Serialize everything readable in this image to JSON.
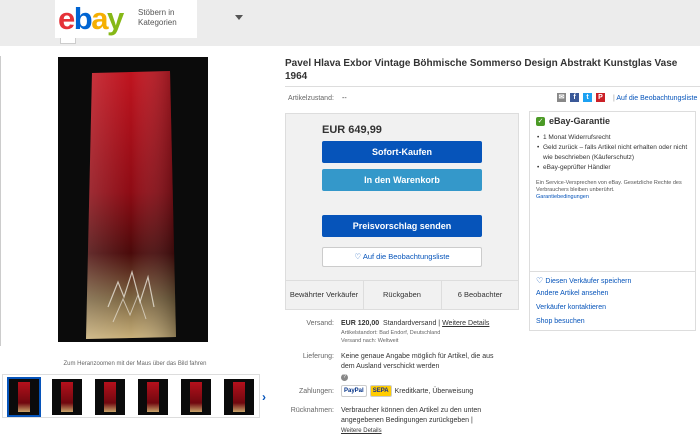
{
  "header": {
    "logo": {
      "e": "e",
      "b": "b",
      "a": "a",
      "y": "y"
    },
    "categories_label": "Stöbern in Kategorien"
  },
  "gallery": {
    "zoom_hint": "Zum Heranzoomen mit der Maus über das Bild fahren",
    "next_icon": "›"
  },
  "item": {
    "title": "Pavel Hlava Exbor Vintage Böhmische Sommerso Design Abstrakt Kunstglas Vase 1964",
    "condition_label": "Artikelzustand:",
    "condition_value": "--",
    "watchlist_link": "Auf die Beobachtungsliste"
  },
  "buybox": {
    "price": "EUR 649,99",
    "buy_now": "Sofort-Kaufen",
    "add_to_cart": "In den Warenkorb",
    "make_offer": "Preisvorschlag senden",
    "watch": "Auf die Beobachtungsliste",
    "stats": [
      "Bewährter Verkäufer",
      "Rückgaben",
      "6 Beobachter"
    ]
  },
  "guarantee": {
    "title": "eBay-Garantie",
    "items": [
      "1 Monat Widerrufsrecht",
      "Geld zurück – falls Artikel nicht erhalten oder nicht wie beschrieben (Käuferschutz)",
      "eBay-geprüfter Händler"
    ],
    "note": "Ein Service-Versprechen von eBay. Gesetzliche Rechte des Verbrauchers bleiben unberührt.",
    "note_link": "Garantiebedingungen",
    "save_seller": "Diesen Verkäufer speichern",
    "other_items": "Andere Artikel ansehen",
    "contact": "Verkäufer kontaktieren",
    "shop": "Shop besuchen"
  },
  "details": {
    "shipping_label": "Versand:",
    "shipping_price": "EUR 120,00",
    "shipping_type": "Standardversand",
    "shipping_link": "Weitere Details",
    "location": "Artikelstandort: Bad Endorf, Deutschland",
    "ships_to": "Versand nach: Weltweit",
    "delivery_label": "Lieferung:",
    "delivery_text_1": "Keine genaue Angabe möglich für Artikel, die aus",
    "delivery_text_2": "dem Ausland verschickt werden",
    "payment_label": "Zahlungen:",
    "paypal": "PayPal",
    "sepa": "SEPA",
    "payment_text": "Kreditkarte, Überweisung",
    "returns_label": "Rücknahmen:",
    "returns_text_1": "Verbraucher können den Artikel zu den unten",
    "returns_text_2": "angegebenen Bedingungen zurückgeben |",
    "returns_link": "Weitere Details"
  },
  "colors": {
    "ebay_red": "#e53238",
    "ebay_blue": "#0064d2",
    "ebay_yellow": "#f5af02",
    "ebay_green": "#86b817",
    "button_primary": "#0654ba",
    "button_secondary": "#3498ca"
  }
}
